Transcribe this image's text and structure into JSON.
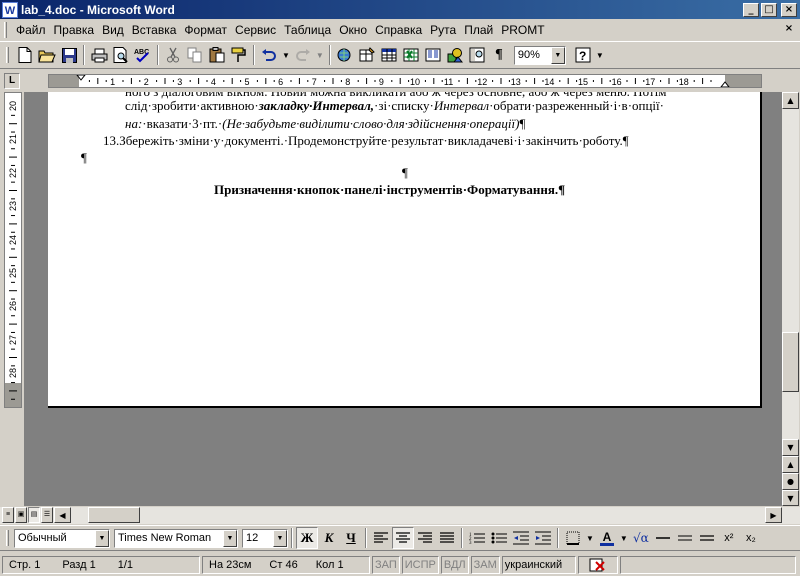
{
  "window": {
    "title": "lab_4.doc - Microsoft Word",
    "app_icon": "W",
    "controls": [
      "_",
      "□",
      "×"
    ]
  },
  "menu": {
    "items": [
      "Файл",
      "Правка",
      "Вид",
      "Вставка",
      "Формат",
      "Сервис",
      "Таблица",
      "Окно",
      "Справка",
      "Рута",
      "Плай",
      "PROMT"
    ],
    "doc_close": "×"
  },
  "toolbar": {
    "icons": [
      "new-icon",
      "open-icon",
      "save-icon",
      "print-icon",
      "preview-icon",
      "spelling-icon",
      "cut-icon",
      "copy-icon",
      "paste-icon",
      "format-painter-icon",
      "undo-icon",
      "redo-icon",
      "hyperlink-icon",
      "tables-borders-icon",
      "insert-table-icon",
      "insert-excel-icon",
      "columns-icon",
      "drawing-icon",
      "doc-map-icon",
      "pilcrow-icon",
      "help-icon"
    ],
    "zoom": "90%"
  },
  "ruler": {
    "tab_marker": "L",
    "h_numbers": [
      "1",
      "2",
      "3",
      "4",
      "5",
      "6",
      "7",
      "8",
      "9",
      "10",
      "11",
      "12",
      "13",
      "14",
      "15",
      "16",
      "17",
      "18"
    ],
    "v_numbers": [
      "20",
      "21",
      "22",
      "23",
      "24",
      "25",
      "26",
      "27",
      "28"
    ]
  },
  "document": {
    "line1": "ного з діалоговим вікном. Новий можна викликати або ж через основне, або ж через меню. Потім",
    "line2_a": "слід·зробити·активною·",
    "line2_b": "закладку·Интервал,",
    "line2_c": "·зі·списку·",
    "line2_d": "Интервал",
    "line2_e": "·обрати·разреженный·і·в·опції·",
    "line3_a": "на:",
    "line3_b": "·вказати·3·пт.·",
    "line3_c": "(Не·забудьте·виділити·слово·для·здійснення·операції)",
    "line3_d": "¶",
    "item13": "13.Збережіть·зміни·у·документі.·Продемонструйте·результат·викладачеві·і·закінчить·роботу.¶",
    "empty_para": "¶",
    "center_para": "¶",
    "heading": "Призначення·кнопок·панелі·інструментів·Форматування.¶"
  },
  "format_toolbar": {
    "style": "Обычный",
    "font": "Times New Roman",
    "size": "12",
    "bold": "Ж",
    "italic": "К",
    "underline": "Ч",
    "superscript": "x²",
    "subscript": "x₂",
    "sqrt": "√α"
  },
  "status": {
    "page": "Стр. 1",
    "section": "Разд 1",
    "pages": "1/1",
    "at": "На 23см",
    "line": "Ст 46",
    "col": "Кол 1",
    "rec": "ЗАП",
    "trk": "ИСПР",
    "ext": "ВДЛ",
    "ovr": "ЗАМ",
    "language": "украинский"
  }
}
